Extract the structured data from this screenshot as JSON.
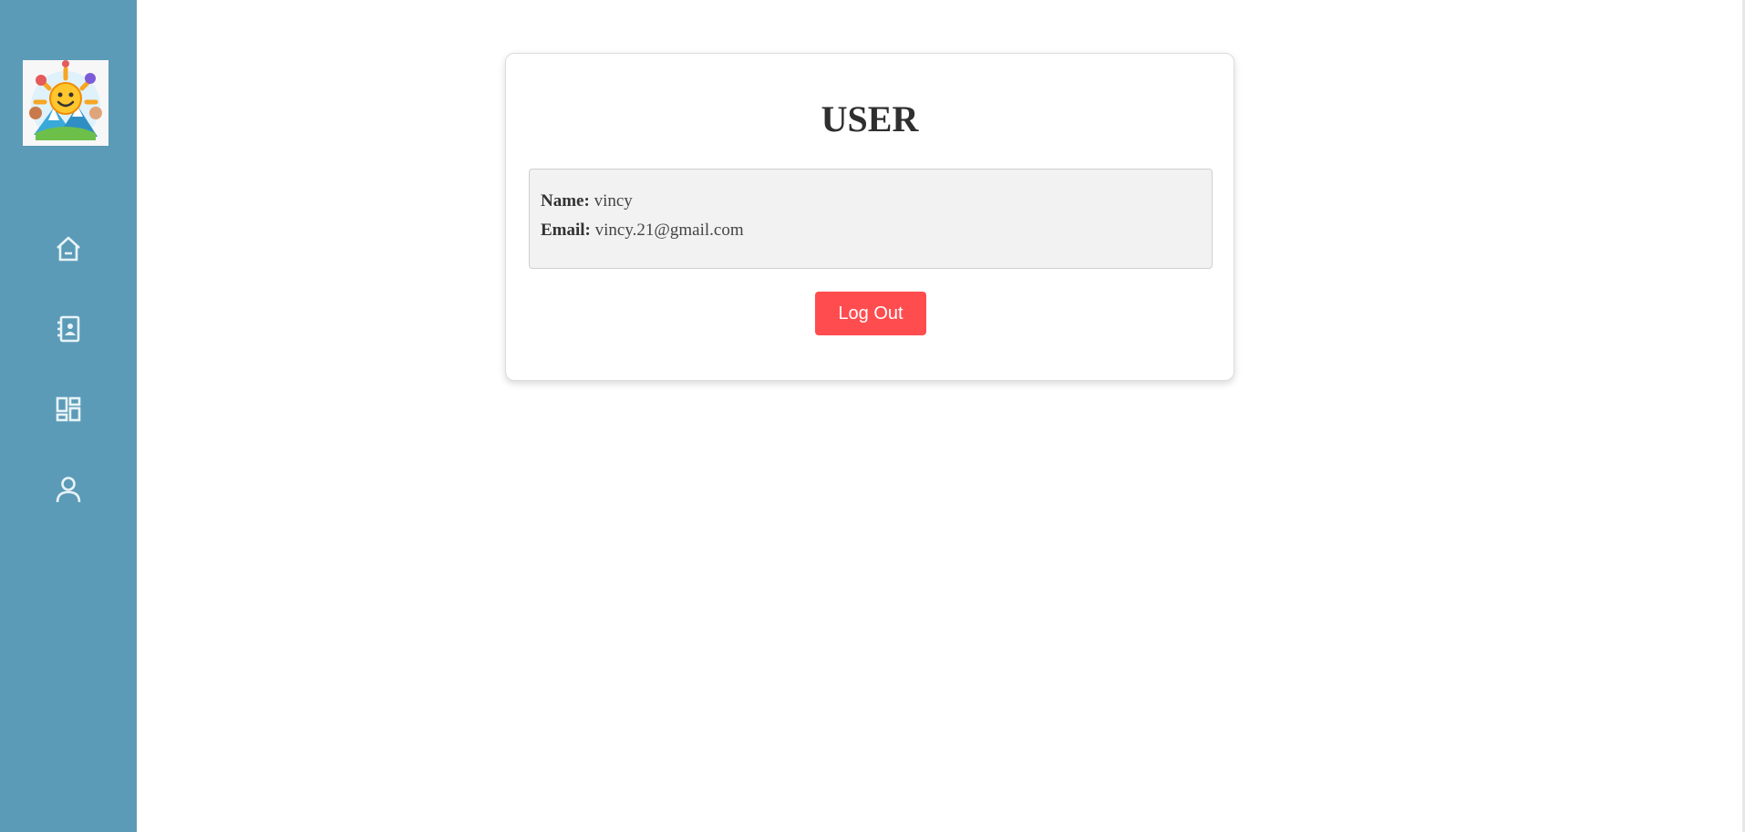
{
  "sidebar": {
    "background": "#5b9bb7",
    "icon_color": "#e8f3f8",
    "logo": {
      "name": "sun-kids-logo"
    },
    "items": [
      {
        "name": "home",
        "icon": "home-icon"
      },
      {
        "name": "contacts",
        "icon": "contact-book-icon"
      },
      {
        "name": "dashboard",
        "icon": "dashboard-icon"
      },
      {
        "name": "user",
        "icon": "user-icon"
      }
    ]
  },
  "profile": {
    "title": "USER",
    "name_label": "Name:",
    "name_value": "vincy",
    "email_label": "Email:",
    "email_value": "vincy.21@gmail.com",
    "logout_label": "Log Out"
  },
  "colors": {
    "logout_button": "#ff4c4f",
    "info_box": "#f2f2f2",
    "title_text": "#2f2f2f"
  }
}
